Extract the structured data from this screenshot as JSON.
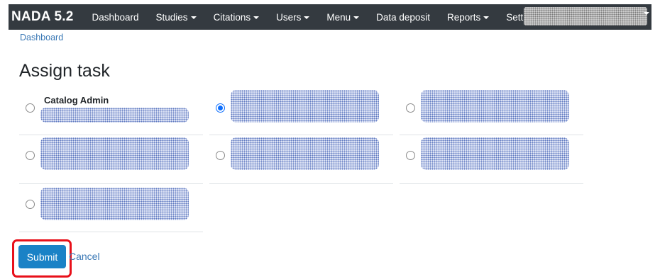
{
  "navbar": {
    "brand": "NADA 5.2",
    "items": [
      {
        "label": "Dashboard",
        "dropdown": false
      },
      {
        "label": "Studies",
        "dropdown": true
      },
      {
        "label": "Citations",
        "dropdown": true
      },
      {
        "label": "Users",
        "dropdown": true
      },
      {
        "label": "Menu",
        "dropdown": true
      },
      {
        "label": "Data deposit",
        "dropdown": false
      },
      {
        "label": "Reports",
        "dropdown": true
      },
      {
        "label": "Settings",
        "dropdown": true
      }
    ],
    "user_menu": {
      "redacted": true,
      "dropdown": true
    }
  },
  "breadcrumb": {
    "label": "Dashboard"
  },
  "page": {
    "title": "Assign task"
  },
  "options": [
    {
      "title": "Catalog Admin",
      "selected": false,
      "redacted": true
    },
    {
      "title": "",
      "selected": true,
      "redacted": true
    },
    {
      "title": "",
      "selected": false,
      "redacted": true
    },
    {
      "title": "",
      "selected": false,
      "redacted": true
    },
    {
      "title": "",
      "selected": false,
      "redacted": true
    },
    {
      "title": "",
      "selected": false,
      "redacted": true
    },
    {
      "title": "",
      "selected": false,
      "redacted": true
    }
  ],
  "actions": {
    "submit_label": "Submit",
    "cancel_label": "Cancel",
    "highlight_color": "#e8101a"
  },
  "colors": {
    "navbar_bg": "#343a40",
    "link": "#3a78b5",
    "primary_button": "#1a82c6",
    "radio_checked": "#0d6efd"
  }
}
